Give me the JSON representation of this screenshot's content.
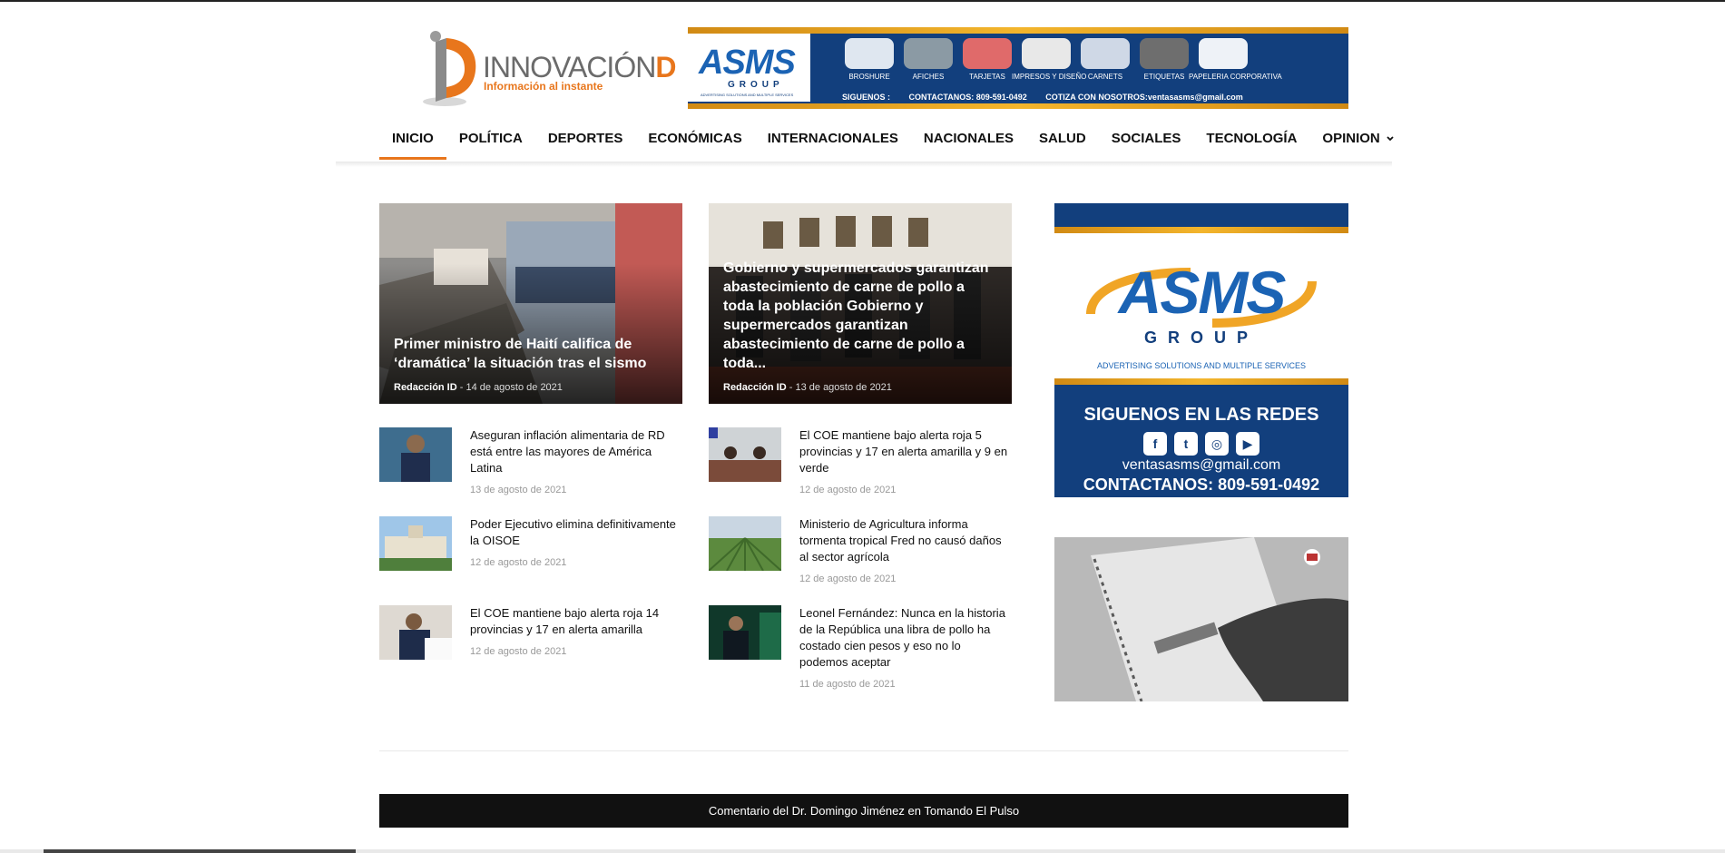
{
  "site": {
    "logo_name": "INNOVACIÓN",
    "logo_letter": "D",
    "tagline": "Información al instante"
  },
  "header_banner": {
    "brand": "ASMS",
    "group": "GROUP",
    "brand_sub": "ADVERTISING SOLUTIONS AND MULTIPLE SERVICES",
    "services": [
      "BROSHURE",
      "AFICHES",
      "TARJETAS",
      "IMPRESOS Y DISEÑO",
      "CARNETS",
      "ETIQUETAS",
      "PAPELERIA CORPORATIVA"
    ],
    "follow": "SIGUENOS :",
    "contact": "CONTACTANOS: 809-591-0492",
    "email": "COTIZA CON NOSOTROS:ventasasms@gmail.com"
  },
  "nav": {
    "items": [
      "INICIO",
      "POLÍTICA",
      "DEPORTES",
      "ECONÓMICAS",
      "INTERNACIONALES",
      "NACIONALES",
      "SALUD",
      "SOCIALES",
      "TECNOLOGÍA",
      "OPINION"
    ],
    "active": "INICIO",
    "dropdown_icon": "chevron-down-icon"
  },
  "featured": [
    {
      "title": "Primer ministro de Haití califica de ‘dramática’ la situación tras el sismo",
      "author": "Redacción ID",
      "separator": "-",
      "date": "14 de agosto de 2021"
    },
    {
      "title": "Gobierno y supermercados garantizan abastecimiento de carne de pollo a toda la población Gobierno y supermercados garantizan abastecimiento de carne de pollo a toda...",
      "author": "Redacción ID",
      "separator": "-",
      "date": "13 de agosto de 2021"
    }
  ],
  "list_left": [
    {
      "title": "Aseguran inflación alimentaria de RD está entre las mayores de América Latina",
      "date": "13 de agosto de 2021"
    },
    {
      "title": "Poder Ejecutivo elimina definitivamente la OISOE",
      "date": "12 de agosto de 2021"
    },
    {
      "title": "El COE mantiene bajo alerta roja 14 provincias y 17 en alerta amarilla",
      "date": "12 de agosto de 2021"
    }
  ],
  "list_right": [
    {
      "title": "El COE mantiene bajo alerta roja 5 provincias y 17 en alerta amarilla y 9 en verde",
      "date": "12 de agosto de 2021"
    },
    {
      "title": "Ministerio de Agricultura informa tormenta tropical Fred no causó daños al sector agrícola",
      "date": "12 de agosto de 2021"
    },
    {
      "title": "Leonel Fernández: Nunca en la historia de la República una libra de pollo ha costado cien pesos y eso no lo podemos aceptar",
      "date": "11 de agosto de 2021"
    }
  ],
  "sidebar_ad": {
    "brand": "ASMS",
    "group": "GROUP",
    "tagline": "ADVERTISING SOLUTIONS AND MULTIPLE SERVICES",
    "follow": "SIGUENOS EN LAS REDES",
    "social_icons": [
      "facebook-icon",
      "twitter-icon",
      "instagram-icon",
      "youtube-icon"
    ],
    "email": "ventasasms@gmail.com",
    "contact": "CONTACTANOS:  809-591-0492"
  },
  "footer_bar": {
    "text": "Comentario del Dr. Domingo Jiménez en Tomando El Pulso"
  },
  "colors": {
    "accent": "#e8761c",
    "banner_blue": "#123f7d",
    "banner_gold": "#f3b52c"
  }
}
